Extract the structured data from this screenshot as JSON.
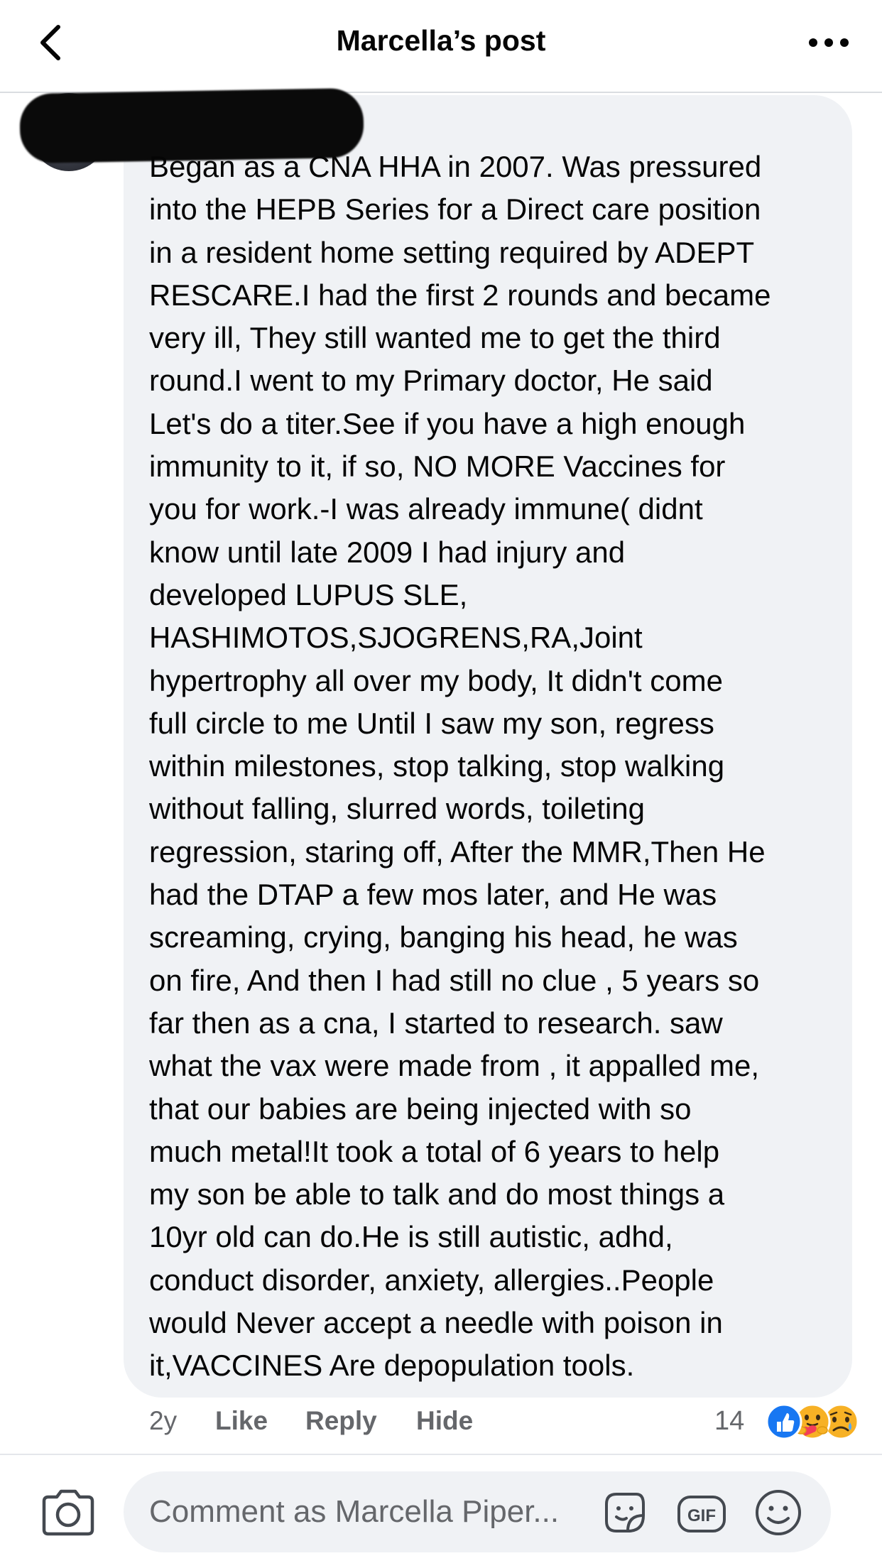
{
  "header": {
    "title": "Marcella’s post"
  },
  "comment": {
    "lines": [
      "Began as a CNA HHA in 2007. Was pressured",
      "into the HEPB Series for a Direct care position",
      "in a resident home setting required by ADEPT",
      "RESCARE.I had the first 2 rounds and became",
      "very ill, They still wanted me to get the third",
      "round.I went to my Primary doctor, He said",
      "Let's do a titer.See if you have a high enough",
      "immunity to it, if so, NO MORE Vaccines for",
      "you for work.-I was already immune( didnt",
      "know until late 2009 I had injury and",
      "developed LUPUS SLE,",
      "HASHIMOTOS,SJOGRENS,RA,Joint",
      "hypertrophy all over my body, It didn't come",
      "full circle to me Until I saw my son, regress",
      "within milestones, stop talking, stop walking",
      "without falling, slurred words, toileting",
      "regression, staring off, After the MMR,Then He",
      "had the DTAP a few mos later, and He was",
      "screaming, crying, banging his head, he was",
      "on fire, And then I had still no clue , 5 years so",
      "far then as a cna, I started to research. saw",
      "what the vax were made from , it appalled me,",
      "that our babies are being injected with so",
      "much metal!It took a total of 6 years to help",
      "my son be able to talk and do most things a",
      "10yr old can do.He is still autistic, adhd,",
      "conduct disorder, anxiety, allergies..People",
      "would Never accept a needle with poison in",
      "it,VACCINES Are depopulation tools."
    ],
    "time": "2y",
    "like_label": "Like",
    "reply_label": "Reply",
    "hide_label": "Hide",
    "reaction_count": "14",
    "reactions": [
      "like-icon",
      "care-icon",
      "sad-icon"
    ]
  },
  "composer": {
    "placeholder": "Comment as Marcella Piper..."
  },
  "colors": {
    "bubble": "#f0f2f5",
    "secondary_text": "#65676b",
    "like_blue": "#1877f2",
    "reaction_yellow": "#f7b125"
  }
}
